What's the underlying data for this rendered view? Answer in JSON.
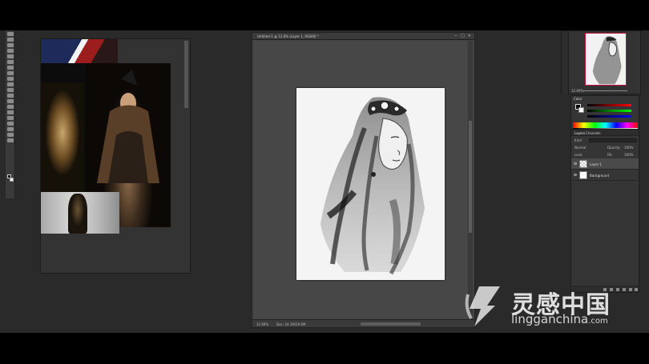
{
  "document": {
    "title": "Untitled-1 @ 12.6% (Layer 1, RGB/8) *",
    "zoom": "12.69%",
    "doc_size": "Doc: 24.1M/29.6M"
  },
  "navigator": {
    "zoom": "12.69%"
  },
  "color_panel": {
    "tab": "Color"
  },
  "layers_panel": {
    "tabs": [
      "Layers",
      "Channels"
    ],
    "kind_label": "Kind",
    "blend_mode": "Normal",
    "opacity_label": "Opacity:",
    "opacity_value": "100%",
    "lock_label": "Lock:",
    "fill_label": "Fill:",
    "fill_value": "100%",
    "layers": [
      {
        "name": "Layer 1",
        "selected": true
      },
      {
        "name": "Background",
        "selected": false
      }
    ]
  },
  "watermark": {
    "chinese": "灵感中国",
    "domain": "lingganchina",
    "tld": ".com"
  },
  "colors": {
    "workspace": "#2a2a2a",
    "panel": "#353535",
    "navigator_frame": "#c0143c"
  }
}
